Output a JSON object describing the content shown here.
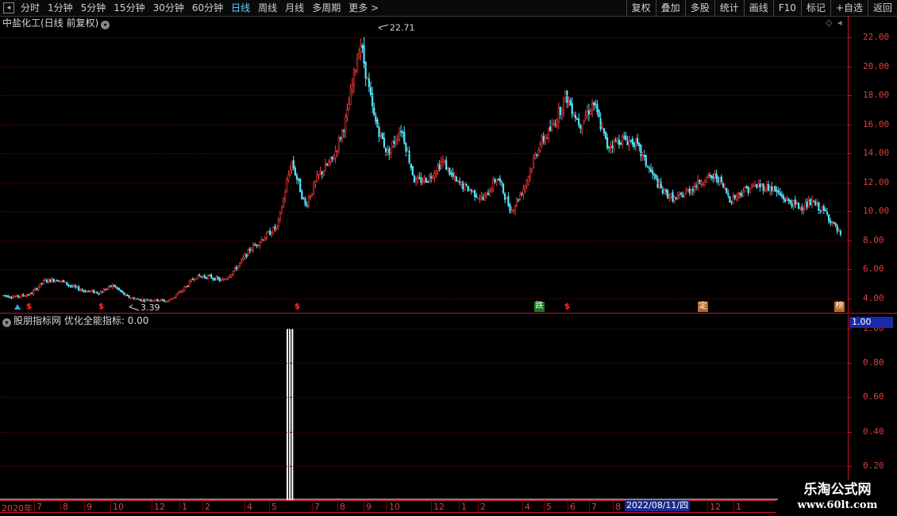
{
  "toolbar": {
    "tabs": [
      {
        "label": "分时",
        "name": "tab-intraday"
      },
      {
        "label": "1分钟",
        "name": "tab-1min"
      },
      {
        "label": "5分钟",
        "name": "tab-5min"
      },
      {
        "label": "15分钟",
        "name": "tab-15min"
      },
      {
        "label": "30分钟",
        "name": "tab-30min"
      },
      {
        "label": "60分钟",
        "name": "tab-60min"
      },
      {
        "label": "日线",
        "name": "tab-daily",
        "active": true
      },
      {
        "label": "周线",
        "name": "tab-weekly"
      },
      {
        "label": "月线",
        "name": "tab-monthly"
      },
      {
        "label": "多周期",
        "name": "tab-multi-period"
      },
      {
        "label": "更多 >",
        "name": "tab-more"
      }
    ],
    "right_buttons": [
      {
        "label": "复权",
        "name": "adjust-button"
      },
      {
        "label": "叠加",
        "name": "overlay-button"
      },
      {
        "label": "多股",
        "name": "multi-stock-button"
      },
      {
        "label": "统计",
        "name": "stats-button"
      },
      {
        "label": "画线",
        "name": "draw-line-button"
      },
      {
        "label": "F10",
        "name": "f10-button"
      },
      {
        "label": "标记",
        "name": "mark-button"
      },
      {
        "label": "+自选",
        "name": "add-watchlist-button"
      },
      {
        "label": "返回",
        "name": "back-button"
      }
    ]
  },
  "main_pane": {
    "title": "中盐化工(日线 前复权)",
    "high_label": "22.71",
    "low_label": "3.39"
  },
  "indicator_pane": {
    "title": "股朋指标网 优化全能指标: 0.00",
    "value_box": "1.00"
  },
  "date_axis": {
    "labels": [
      "2020年",
      "7",
      "8",
      "9",
      "10",
      "12",
      "1",
      "2",
      "4",
      "5",
      "7",
      "8",
      "9",
      "10",
      "12",
      "1",
      "2",
      "4",
      "5",
      "6",
      "7",
      "8",
      "12",
      "1"
    ],
    "selected": "2022/08/11/四"
  },
  "markers": [
    {
      "type": "s",
      "text": "$"
    },
    {
      "type": "s",
      "text": "$"
    },
    {
      "type": "s",
      "text": "$"
    },
    {
      "type": "s",
      "text": "$"
    },
    {
      "type": "box",
      "text": "跌"
    },
    {
      "type": "box",
      "text": "定"
    },
    {
      "type": "box",
      "text": "榜"
    }
  ],
  "watermark": {
    "line1": "乐淘公式网",
    "line2": "www.60lt.com"
  },
  "colors": {
    "up": "#ff3b3b",
    "down": "#54e4ff",
    "axis": "#c8102e",
    "grid": "#5a0000",
    "indicator": "#ffffff"
  },
  "chart_data": [
    {
      "type": "candlestick",
      "title": "中盐化工(日线 前复权)",
      "ylim": [
        3.0,
        23.5
      ],
      "y_ticks": [
        4.0,
        6.0,
        8.0,
        10.0,
        12.0,
        14.0,
        16.0,
        18.0,
        20.0,
        22.0
      ],
      "x_labels": [
        "2020年",
        "7",
        "8",
        "9",
        "10",
        "12",
        "1",
        "2",
        "4",
        "5",
        "7",
        "8",
        "9",
        "10",
        "12",
        "1",
        "2",
        "4",
        "5",
        "6",
        "7",
        "8",
        "12",
        "1"
      ],
      "annotations": [
        {
          "text": "22.71",
          "value": 22.71
        },
        {
          "text": "3.39",
          "value": 3.39
        }
      ],
      "price_path": [
        4.2,
        4.1,
        4.3,
        5.2,
        5.3,
        4.8,
        4.5,
        4.4,
        4.9,
        4.1,
        3.9,
        3.9,
        3.8,
        4.5,
        5.5,
        5.5,
        5.2,
        6.1,
        7.4,
        8.2,
        9.0,
        13.5,
        10.4,
        12.5,
        13.6,
        16.4,
        21.8,
        16.5,
        14.0,
        15.8,
        12.0,
        12.3,
        13.5,
        12.0,
        11.5,
        10.8,
        12.4,
        10.0,
        11.8,
        14.5,
        15.8,
        18.0,
        16.0,
        17.5,
        14.5,
        15.0,
        14.8,
        13.0,
        11.4,
        10.8,
        11.5,
        12.2,
        12.4,
        10.8,
        11.5,
        11.8,
        11.6,
        10.8,
        10.3,
        10.6,
        9.8,
        8.3
      ]
    },
    {
      "type": "bar",
      "title": "优化全能指标",
      "ylim": [
        0,
        1.0
      ],
      "y_ticks": [
        0.2,
        0.4,
        0.6,
        0.8,
        1.0
      ],
      "signals": [
        {
          "position": 0.338,
          "value": 1.0
        },
        {
          "position": 0.341,
          "value": 1.0
        },
        {
          "position": 0.344,
          "value": 1.0
        }
      ]
    }
  ]
}
